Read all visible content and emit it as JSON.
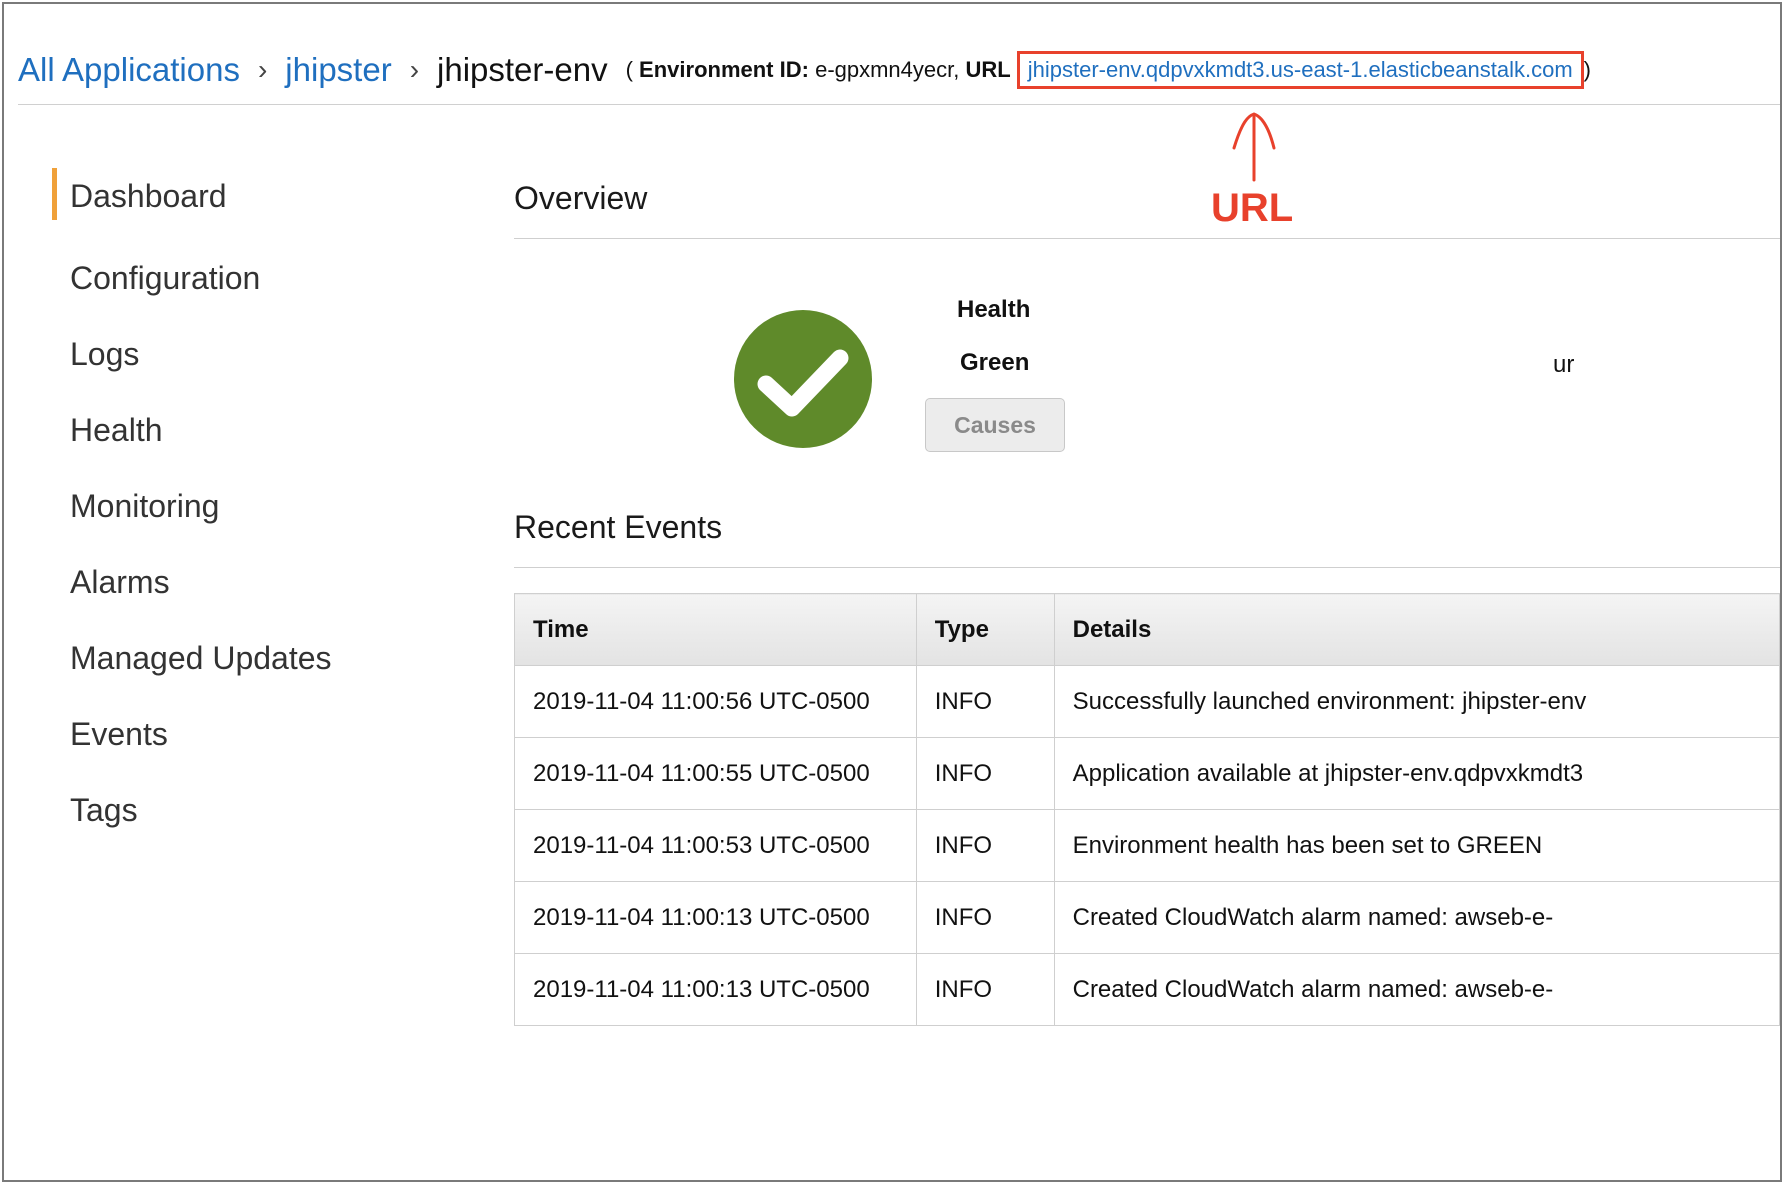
{
  "breadcrumb": {
    "all_applications": "All Applications",
    "separator": "›",
    "application": "jhipster",
    "environment": "jhipster-env",
    "meta_open": "(",
    "env_id_label": "Environment ID:",
    "env_id_value": "e-gpxmn4yecr,",
    "url_label": "URL",
    "url_value": "jhipster-env.qdpvxkmdt3.us-east-1.elasticbeanstalk.com",
    "meta_close": ")"
  },
  "annotation": {
    "label": "URL",
    "color": "#e8412c"
  },
  "nav": {
    "items": [
      {
        "label": "Dashboard",
        "active": true
      },
      {
        "label": "Configuration"
      },
      {
        "label": "Logs"
      },
      {
        "label": "Health"
      },
      {
        "label": "Monitoring"
      },
      {
        "label": "Alarms"
      },
      {
        "label": "Managed Updates"
      },
      {
        "label": "Events"
      },
      {
        "label": "Tags"
      }
    ],
    "active_color": "#f0a13a"
  },
  "overview": {
    "title": "Overview",
    "health_label": "Health",
    "health_status": "Green",
    "health_icon": "check-circle-icon",
    "health_color": "#5f8a2a",
    "causes_button": "Causes",
    "clipped_text": "ur"
  },
  "events": {
    "title": "Recent Events",
    "columns": [
      "Time",
      "Type",
      "Details"
    ],
    "rows": [
      {
        "time": "2019-11-04 11:00:56 UTC-0500",
        "type": "INFO",
        "details": "Successfully launched environment: jhipster-env"
      },
      {
        "time": "2019-11-04 11:00:55 UTC-0500",
        "type": "INFO",
        "details": "Application available at jhipster-env.qdpvxkmdt3"
      },
      {
        "time": "2019-11-04 11:00:53 UTC-0500",
        "type": "INFO",
        "details": "Environment health has been set to GREEN"
      },
      {
        "time": "2019-11-04 11:00:13 UTC-0500",
        "type": "INFO",
        "details": "Created CloudWatch alarm named: awseb-e-"
      },
      {
        "time": "2019-11-04 11:00:13 UTC-0500",
        "type": "INFO",
        "details": "Created CloudWatch alarm named: awseb-e-"
      }
    ],
    "info_color": "#5b8a1a"
  }
}
